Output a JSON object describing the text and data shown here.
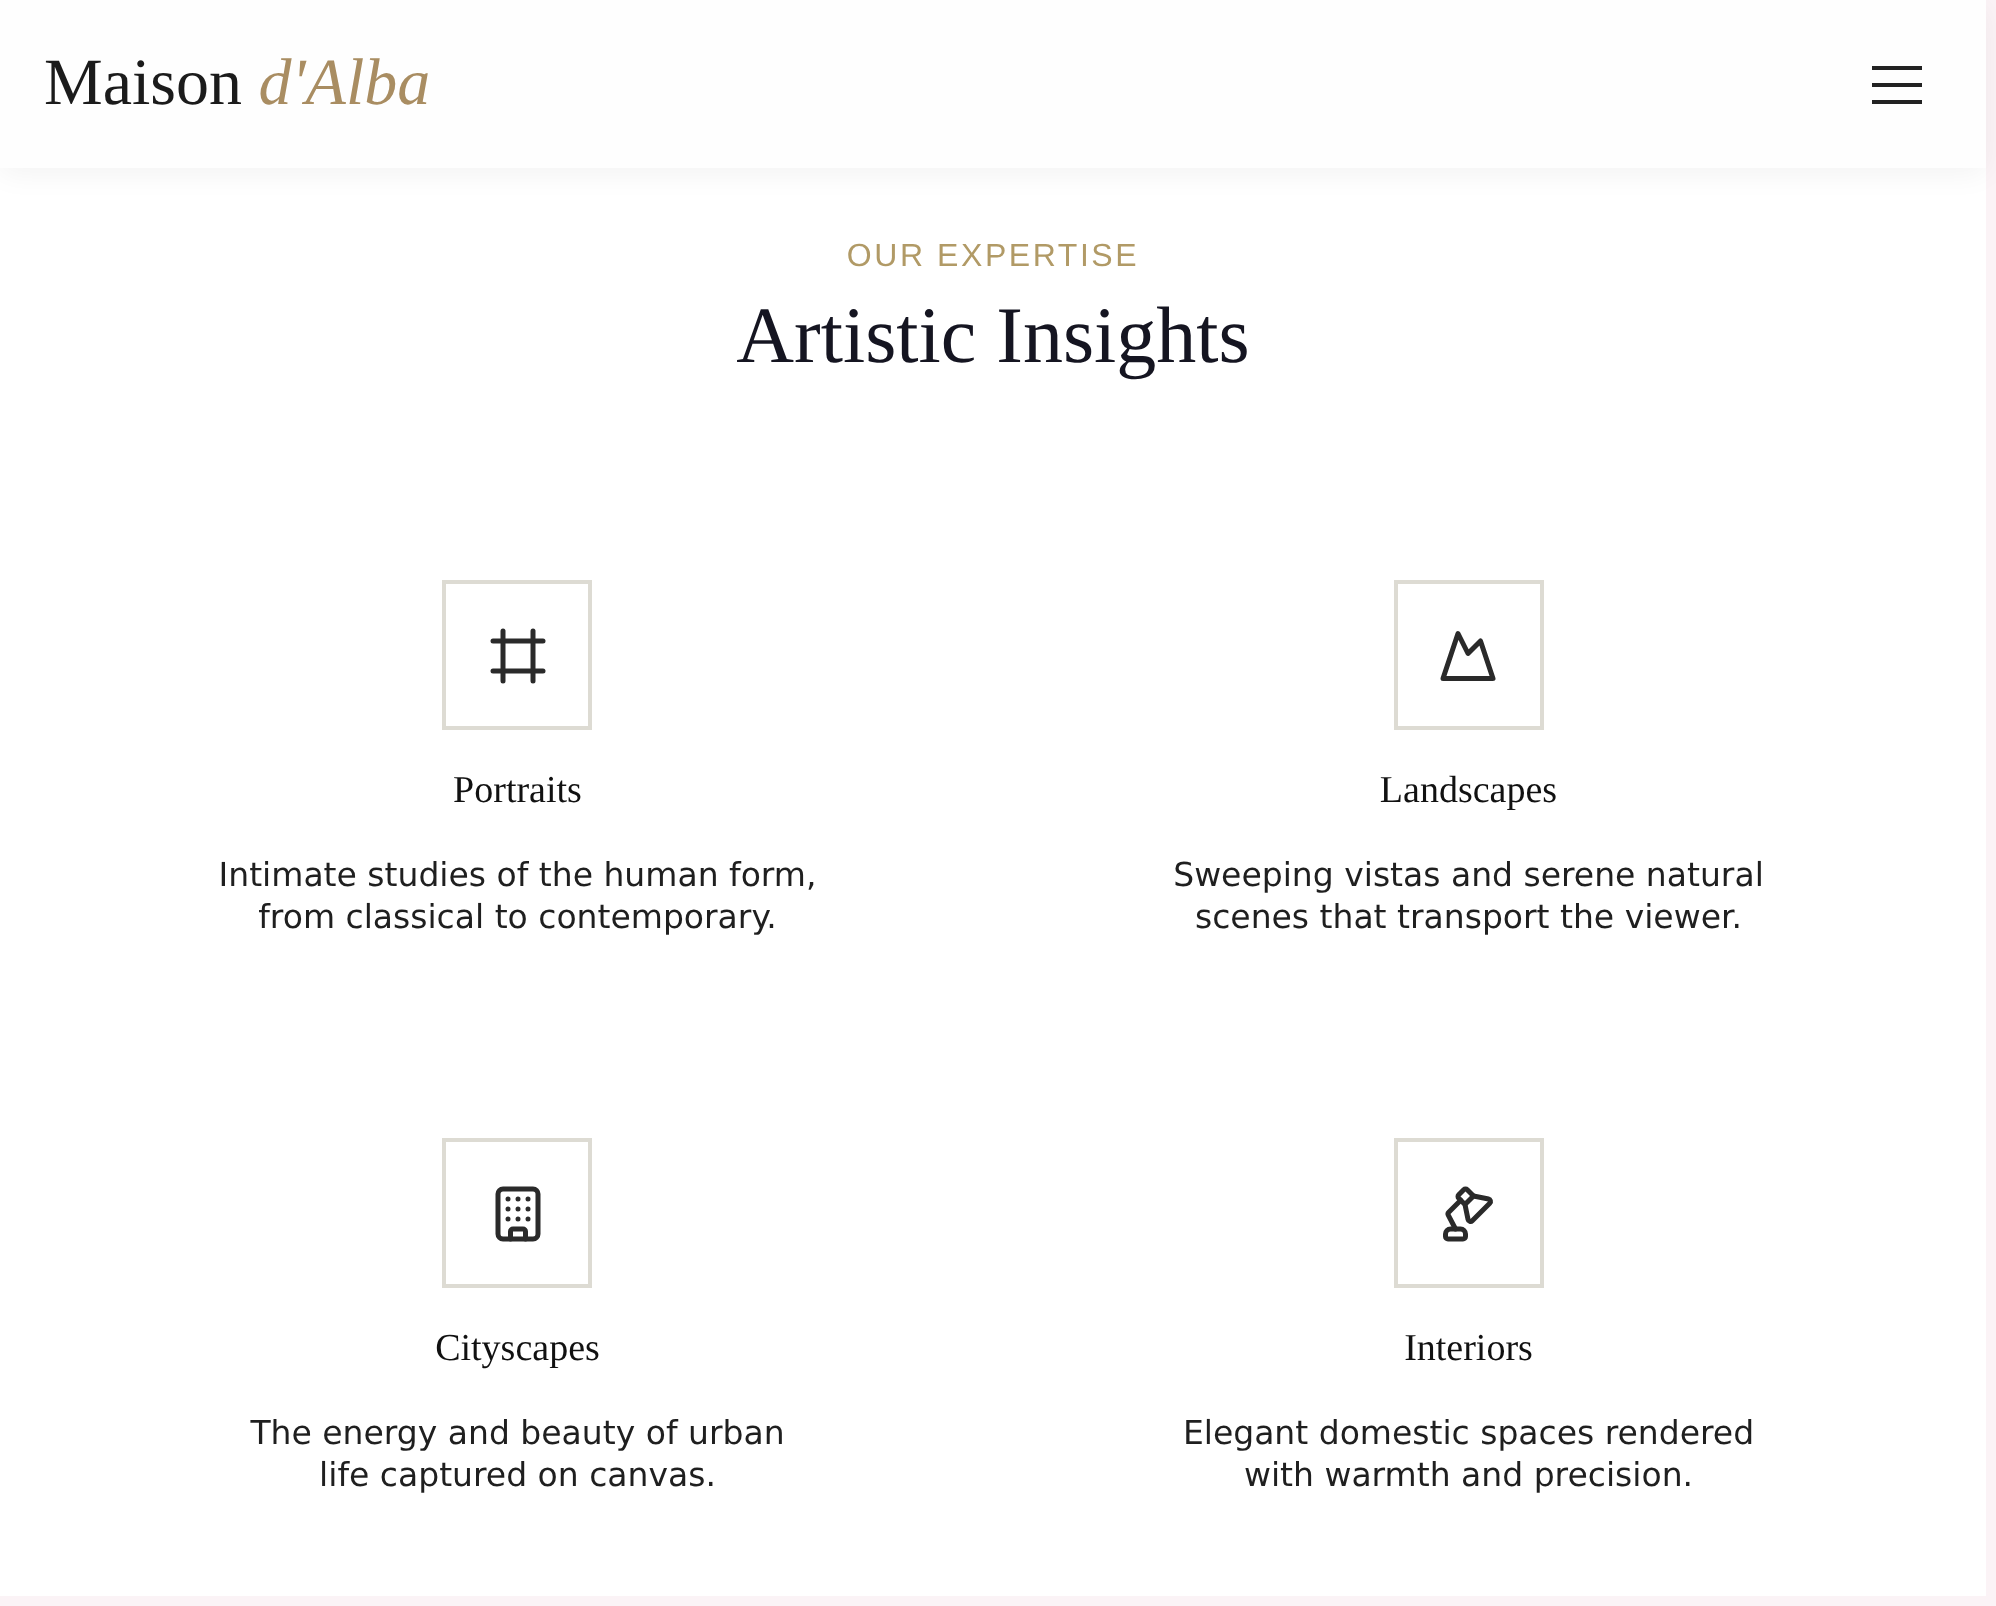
{
  "header": {
    "logo": "Maison *d'Alba*"
  },
  "section": {
    "eyebrow": "OUR EXPERTISE",
    "title": "Artistic Insights"
  },
  "cards": [
    {
      "title": "Portraits",
      "description": "Intimate studies of the human form, from classical to contemporary."
    },
    {
      "title": "Landscapes",
      "description": "Sweeping vistas and serene natural scenes that transport the viewer."
    },
    {
      "title": "Cityscapes",
      "description": "The energy and beauty of urban life captured on canvas."
    },
    {
      "title": "Interiors",
      "description": "Elegant domestic spaces rendered with warmth and precision."
    }
  ]
}
